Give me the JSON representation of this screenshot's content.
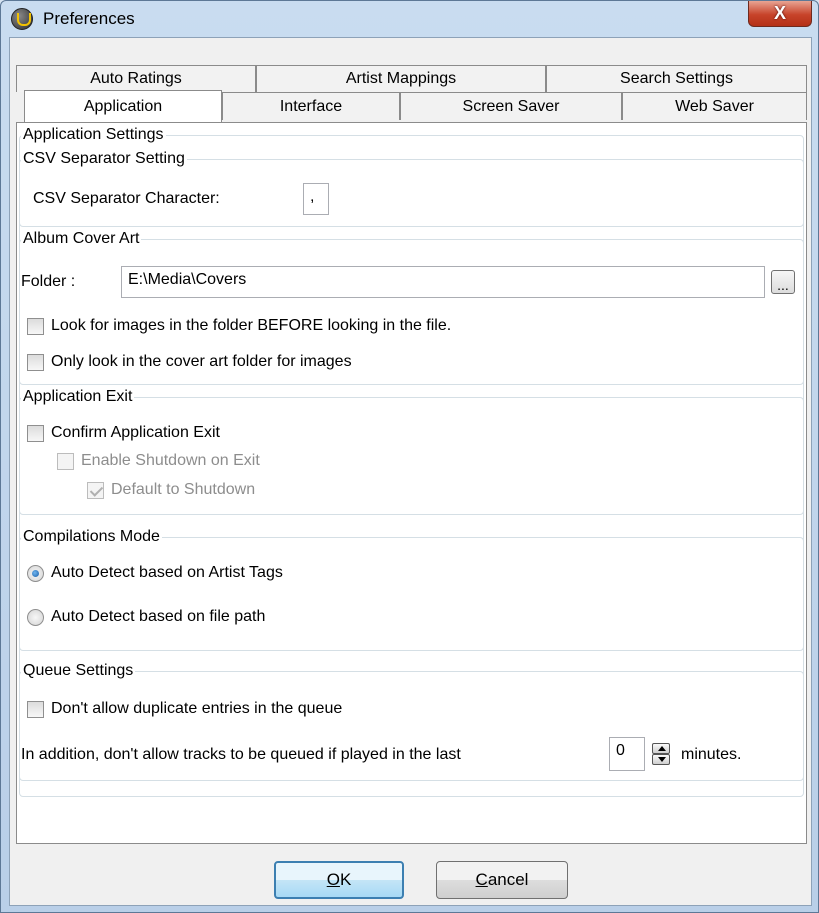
{
  "window": {
    "title": "Preferences",
    "close_glyph": "X"
  },
  "tabs": {
    "row1": [
      "Auto Ratings",
      "Artist Mappings",
      "Search Settings"
    ],
    "row2": [
      "Application",
      "Interface",
      "Screen Saver",
      "Web Saver"
    ],
    "selected": "Application"
  },
  "app_settings": {
    "legend": "Application Settings"
  },
  "csv": {
    "legend": "CSV Separator Setting",
    "label": "CSV Separator Character:",
    "value": ","
  },
  "cover_art": {
    "legend": "Album Cover Art",
    "folder_label": "Folder :",
    "folder_value": "E:\\Media\\Covers",
    "browse_label": "...",
    "check1_label": "Look for images in the folder BEFORE looking in the file.",
    "check1_checked": false,
    "check2_label": "Only look in the cover art folder for images",
    "check2_checked": false
  },
  "exit": {
    "legend": "Application Exit",
    "confirm_label": "Confirm Application Exit",
    "confirm_checked": false,
    "shutdown_label": "Enable Shutdown on Exit",
    "shutdown_checked": false,
    "default_label": "Default to Shutdown",
    "default_checked": true
  },
  "compilations": {
    "legend": "Compilations Mode",
    "option1": "Auto Detect based on Artist Tags",
    "option2": "Auto Detect based on file path",
    "selected": "option1"
  },
  "queue": {
    "legend": "Queue Settings",
    "dup_label": "Don't allow duplicate entries in the queue",
    "dup_checked": false,
    "played_prefix": "In addition, don't allow tracks to be queued if played in the last",
    "minutes_value": "0",
    "played_suffix": "minutes."
  },
  "buttons": {
    "ok_accel": "O",
    "ok_rest": "K",
    "cancel_accel": "C",
    "cancel_rest": "ancel"
  },
  "colors": {
    "accent": "#3c7fb1",
    "close": "#c7432a"
  }
}
